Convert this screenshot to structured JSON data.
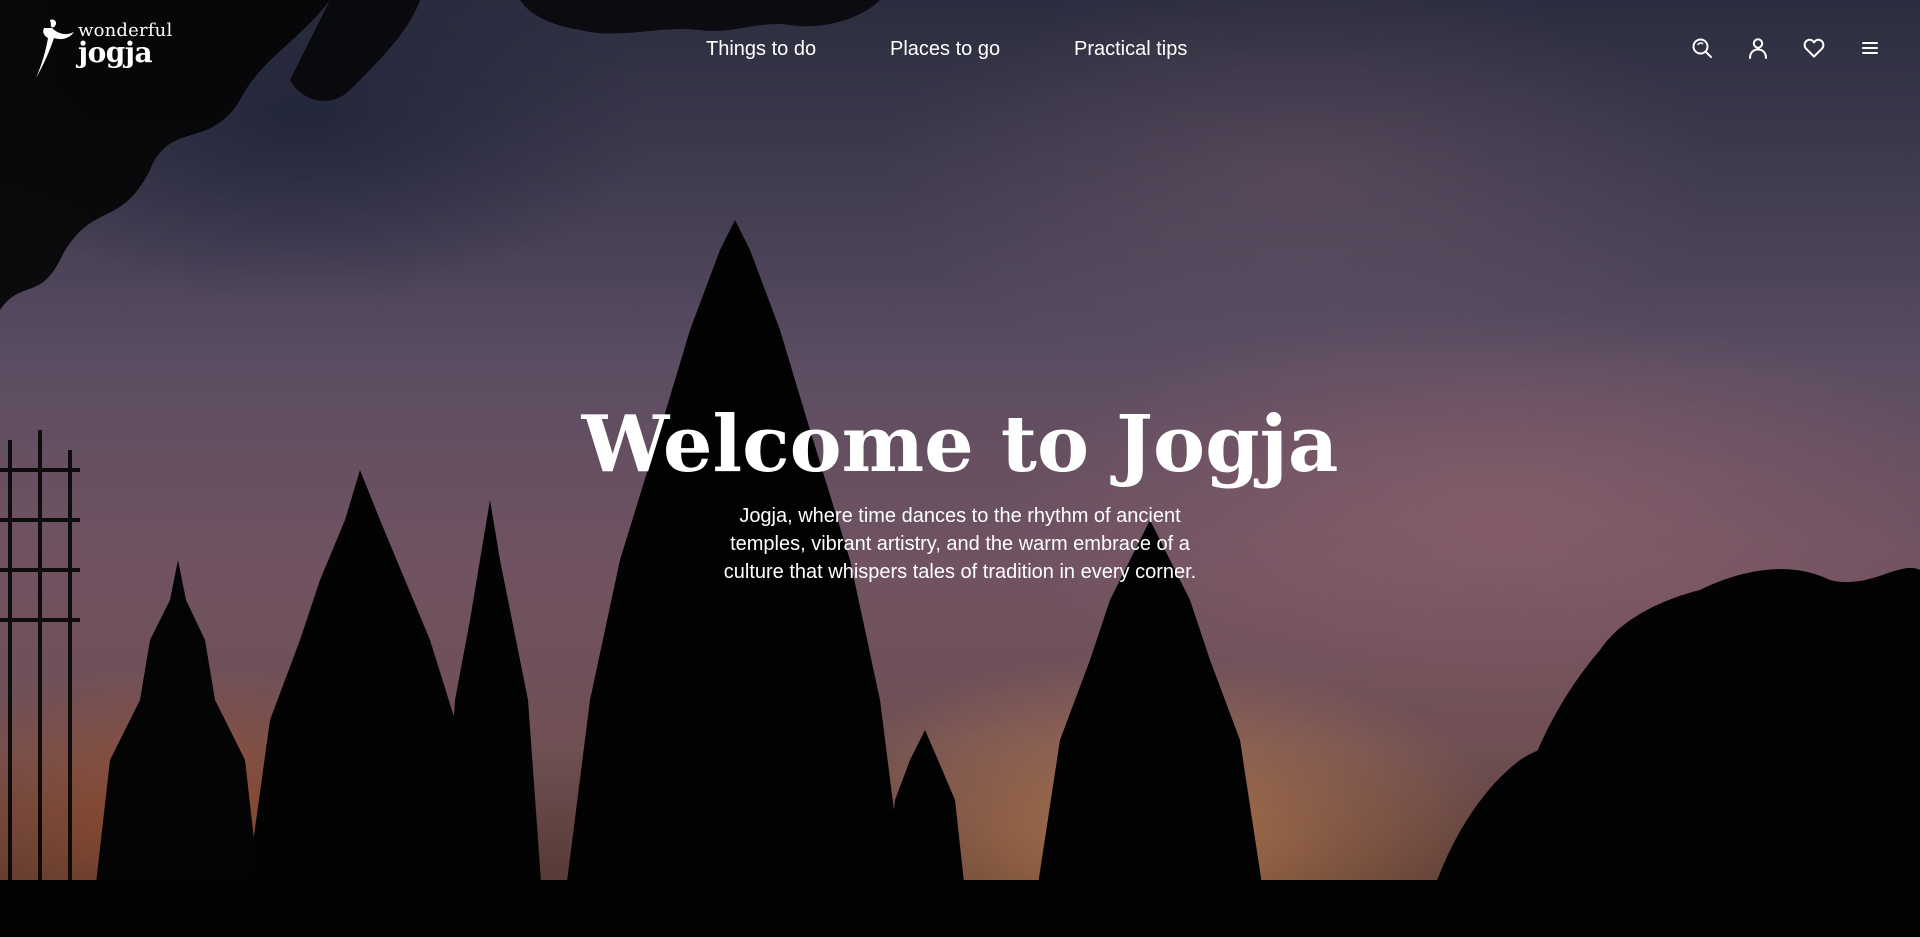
{
  "brand": {
    "logo_top": "wonderful",
    "logo_main": "jogja"
  },
  "nav": {
    "items": [
      {
        "label": "Things to do"
      },
      {
        "label": "Places to go"
      },
      {
        "label": "Practical tips"
      }
    ]
  },
  "toolbar": {
    "icons": [
      "search-icon",
      "user-icon",
      "heart-icon",
      "menu-icon"
    ]
  },
  "hero": {
    "title": "Welcome to Jogja",
    "subtitle": "Jogja, where time dances to the rhythm of ancient temples, vibrant artistry, and the warm embrace of a culture that whispers tales of tradition in every corner."
  },
  "colors": {
    "text": "#ffffff",
    "sky_top": "#3a3c55",
    "sky_mid": "#7a5a6b",
    "glow": "#e29658"
  }
}
